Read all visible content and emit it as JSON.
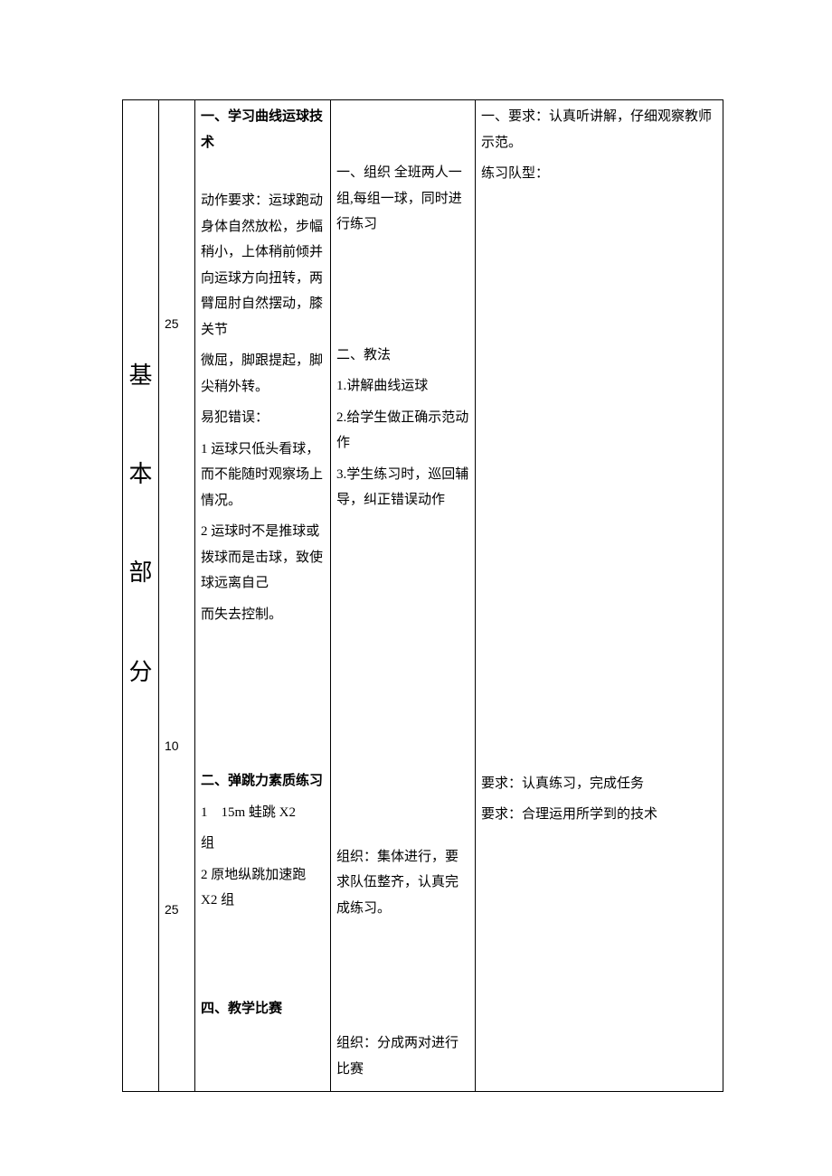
{
  "part_label": "基\n\n本\n\n部\n\n分",
  "times": {
    "t1": "25",
    "t2": "10",
    "t3": "25"
  },
  "content": {
    "h1": "一、学习曲线运球技术",
    "p1": "动作要求：运球跑动身体自然放松，步幅稍小，上体稍前倾并向运球方向扭转，两臂屈肘自然摆动，膝关节",
    "p1b": "微屈，脚跟提起，脚尖稍外转。",
    "err_h": "易犯错误：",
    "err1": "1 运球只低头看球，而不能随时观察场上情况。",
    "err2": "2 运球时不是推球或拨球而是击球，致使球远离自己",
    "err2b": "而失去控制。",
    "h2": "二、弹跳力素质练习",
    "j1a": "1",
    "j1b": "15m 蛙跳 X2",
    "j1c": "组",
    "j2": "2 原地纵跳加速跑 X2 组",
    "h4": "四、教学比赛"
  },
  "method": {
    "m1": "一、组织 全班两人一组,每组一球，同时进行练习",
    "m2h": "二、教法",
    "m2a": "1.讲解曲线运球",
    "m2b": "2.给学生做正确示范动作",
    "m2c": "3.学生练习时，巡回辅导，纠正错误动作",
    "m3": "组织：集体进行，要求队伍整齐，认真完成练习。",
    "m4": "组织：分成两对进行比赛"
  },
  "req": {
    "r1": "一、要求：认真听讲解，仔细观察教师示范。",
    "r1b": "练习队型：",
    "r2a": "要求：认真练习，完成任务",
    "r2b": "要求：合理运用所学到的技术"
  }
}
